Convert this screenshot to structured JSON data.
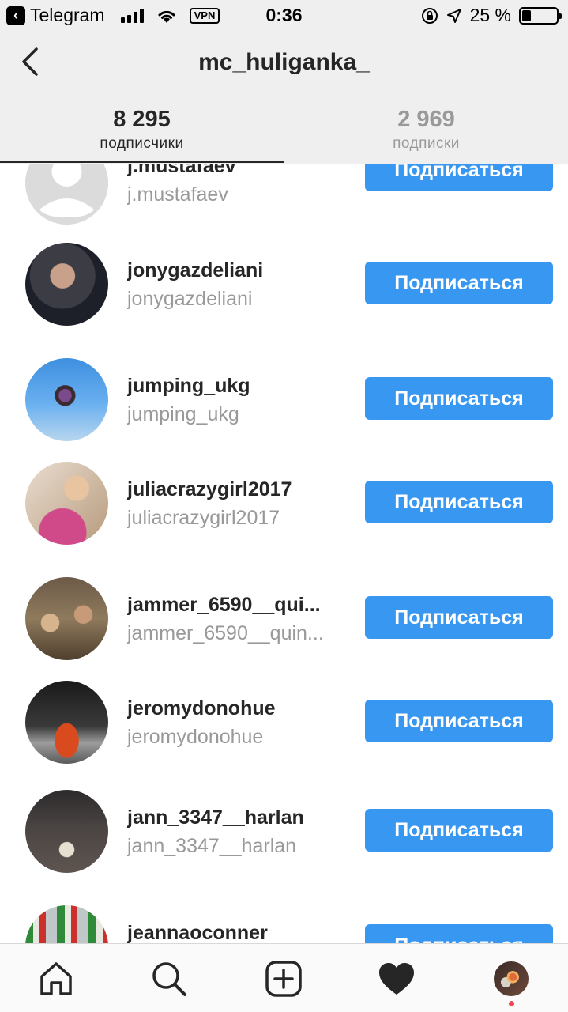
{
  "status_bar": {
    "back_app": "Telegram",
    "vpn": "VPN",
    "time": "0:36",
    "battery": "25 %",
    "battery_level": 0.25
  },
  "header": {
    "title": "mc_huliganka_",
    "tabs": [
      {
        "count": "8 295",
        "label": "подписчики",
        "active": true
      },
      {
        "count": "2 969",
        "label": "подписки",
        "active": false
      }
    ]
  },
  "follow_label": "Подписаться",
  "followers": [
    {
      "username": "j.mustafaev",
      "name": "j.mustafaev",
      "avatar": "default-avatar"
    },
    {
      "username": "jonygazdeliani",
      "name": "jonygazdeliani",
      "avatar": "photo"
    },
    {
      "username": "jumping_ukg",
      "name": "jumping_ukg",
      "avatar": "photo"
    },
    {
      "username": "juliacrazygirl2017",
      "name": "juliacrazygirl2017",
      "avatar": "photo"
    },
    {
      "username": "jammer_6590__qui...",
      "name": "jammer_6590__quin...",
      "avatar": "photo"
    },
    {
      "username": "jeromydonohue",
      "name": "jeromydonohue",
      "avatar": "photo"
    },
    {
      "username": "jann_3347__harlan",
      "name": "jann_3347__harlan",
      "avatar": "photo"
    },
    {
      "username": "jeannaoconner",
      "name": "",
      "avatar": "photo"
    }
  ],
  "bottom_nav": [
    {
      "icon": "home-icon"
    },
    {
      "icon": "search-icon"
    },
    {
      "icon": "add-post-icon"
    },
    {
      "icon": "heart-icon"
    },
    {
      "icon": "profile-avatar"
    }
  ]
}
